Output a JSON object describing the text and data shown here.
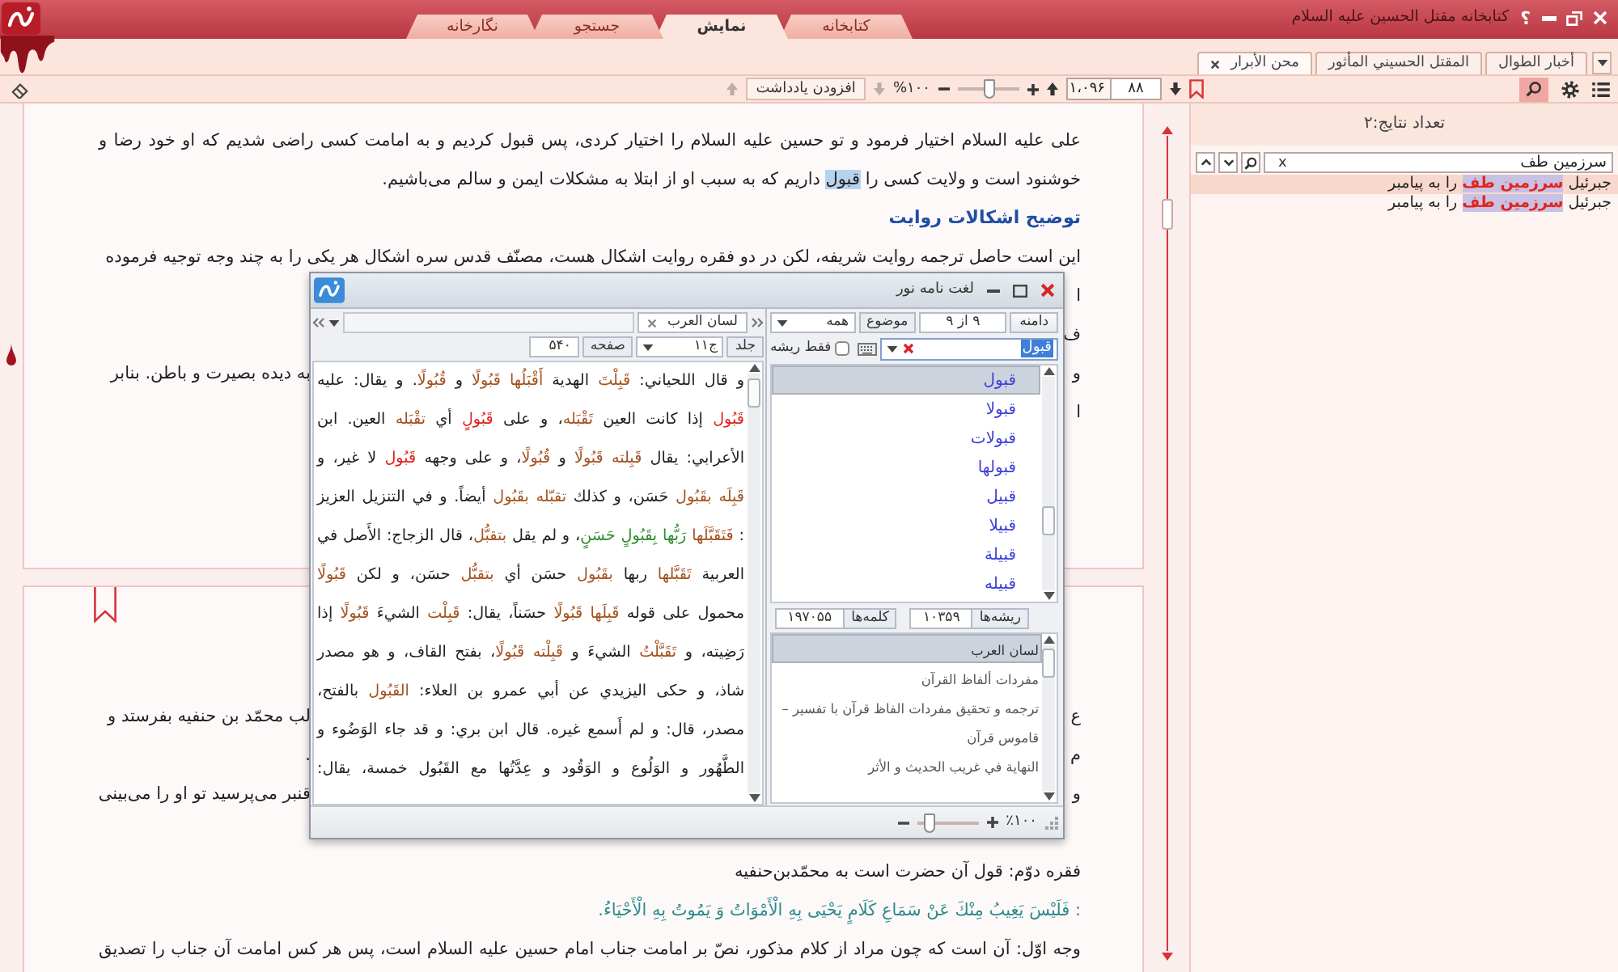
{
  "window": {
    "title": "کتابخانه مقتل الحسین علیه السلام",
    "help": "؟"
  },
  "main_tabs": [
    {
      "label": "کتابخانه",
      "selected": false
    },
    {
      "label": "نمایش",
      "selected": true
    },
    {
      "label": "جستجو",
      "selected": false
    },
    {
      "label": "نگارخانه",
      "selected": false
    }
  ],
  "document_tabs": [
    {
      "label": "أخبار الطوال",
      "selected": false
    },
    {
      "label": "المقتل الحسيني المأثور",
      "selected": false
    },
    {
      "label": "محن الأبرار",
      "selected": true
    }
  ],
  "toolbar": {
    "search_active": true,
    "page_down": {
      "disabled": false
    },
    "page": "۸۸",
    "total_pages": "۱،۰۹۶",
    "page_up": {
      "disabled": false
    },
    "zoom_slider": {
      "level": 0.5
    },
    "zoom_text": "%۱۰۰",
    "note_down": {
      "disabled": true
    },
    "add_note": "افزودن یادداشت",
    "note_up": {
      "disabled": true
    }
  },
  "search_panel": {
    "result_count": "تعداد نتایج:۲",
    "query": "سرزمین طف",
    "clear": "x",
    "results": [
      {
        "text": "جبرئیل **سرزمین طف** را به پیامبر",
        "selected": true
      },
      {
        "text": "جبرئیل **سرزمین طف** را به پیامبر",
        "selected": false
      }
    ]
  },
  "document": {
    "sections": [
      {
        "bookmarked": false,
        "blocks": [
          {
            "kind": "paragraph",
            "continues": false,
            "lines": [
              [
                {
                  "kind": "plain",
                  "text": "علی علیه السلام اختیار فرمود و تو حسین علیه السلام را اختیار کردی، پس قبول کردیم و به امامت کسی راضی شدیم که او خود رضا و"
                }
              ],
              [
                {
                  "kind": "plain",
                  "text": "خوشنود است و ولایت کسی را "
                },
                {
                  "kind": "highlight",
                  "text": "قبول"
                },
                {
                  "kind": "plain",
                  "text": " داریم که به سبب او از ابتلا به مشکلات ایمن و سالم می‌باشیم."
                }
              ]
            ]
          },
          {
            "kind": "heading",
            "text": "توضیح اشکالات روایت"
          },
          {
            "kind": "paragraph",
            "lines": [
              [
                {
                  "kind": "plain",
                  "text": "این است حاصل ترجمه روایت شریفه، لکن در دو فقره روایت اشکال هست، مصنّف قدس سره اشکال هر یکی را به چند وجه توجیه فرموده"
                }
              ]
            ]
          },
          {
            "kind": "covered",
            "rows": [
              {
                "line_start": "ا"
              },
              {
                "line_start": "ف"
              },
              {
                "line_start": "و",
                "line_end": "به دیده بصیرت و باطن. بنابر"
              },
              {
                "line_start": "ا"
              }
            ]
          }
        ]
      },
      {
        "bookmarked": true,
        "blocks": [
          {
            "kind": "covered",
            "rows": [
              {
                "line_start": "ع",
                "line_end": "لب محمّد بن حنفیه بفرستد و"
              },
              {
                "line_start": "م",
                "line_end": "."
              },
              {
                "line_start": "و",
                "line_end": "قنبر می‌پرسید تو او را می‌بینی"
              }
            ]
          },
          {
            "kind": "paragraph",
            "continues": false,
            "lines": [
              [
                {
                  "kind": "plain",
                  "text": "فقره دوّم: قول آن حضرت است به محمّدبن‌حنفیه"
                }
              ]
            ]
          },
          {
            "kind": "verse",
            "text": ": فَلَيْسَ يَغِيبُ مِنْكَ عَنْ سَمَاعِ كَلَامٍ يَحْيَى بِهِ الْأَمْوَاتُ وَ يَمُوتُ بِهِ الْأَحْيَاءُ."
          },
          {
            "kind": "paragraph",
            "continues": true,
            "lines": [
              [
                {
                  "kind": "plain",
                  "text": "وجه اوّل: آن است که چون مراد از کلام مذکور، نصّ بر امامت جناب امام حسین علیه السلام است، پس هر کس امامت آن جناب را تصدیق"
                }
              ]
            ]
          }
        ]
      }
    ]
  },
  "dictionary_window": {
    "title": "لغت نامه نور",
    "book_tabs": [
      {
        "label": "لسان العرب",
        "selected": true
      }
    ],
    "volume_label": "جلد",
    "volume": "ج۱۱",
    "page_label": "صفحه",
    "page": "۵۴۰",
    "text_lines": [
      [
        {
          "kind": "plain",
          "text": "و قال اللحياني: "
        },
        {
          "kind": "derived",
          "text": "قَبِلْتَ"
        },
        {
          "kind": "plain",
          "text": " الهدية "
        },
        {
          "kind": "derived",
          "text": "أَقْبَلُها"
        },
        {
          "kind": "derived",
          "text": " قَبُولًا"
        },
        {
          "kind": "plain",
          "text": " و "
        },
        {
          "kind": "derived",
          "text": "قُبُولًا"
        },
        {
          "kind": "plain",
          "text": ". و يقال: عليه"
        }
      ],
      [
        {
          "kind": "exact",
          "text": "قَبُول"
        },
        {
          "kind": "plain",
          "text": " إذا كانت العين "
        },
        {
          "kind": "derived",
          "text": "تَقْبَله"
        },
        {
          "kind": "plain",
          "text": "، و على "
        },
        {
          "kind": "exact",
          "text": "قَبُولٍ"
        },
        {
          "kind": "plain",
          "text": " أي "
        },
        {
          "kind": "derived",
          "text": "تقْبَله"
        },
        {
          "kind": "plain",
          "text": " العين. ابن"
        }
      ],
      [
        {
          "kind": "plain",
          "text": "الأعرابي: يقال "
        },
        {
          "kind": "derived",
          "text": "قَبِلته"
        },
        {
          "kind": "derived",
          "text": " قَبُولًا"
        },
        {
          "kind": "plain",
          "text": " و "
        },
        {
          "kind": "derived",
          "text": "قُبُولًا"
        },
        {
          "kind": "plain",
          "text": "، و على وجهه "
        },
        {
          "kind": "exact",
          "text": "قَبُول"
        },
        {
          "kind": "plain",
          "text": " لا غير، و"
        }
      ],
      [
        {
          "kind": "derived",
          "text": "قَبِلَه"
        },
        {
          "kind": "derived",
          "text": " بقَبُول"
        },
        {
          "kind": "plain",
          "text": " حَسَن، و كذلك "
        },
        {
          "kind": "derived",
          "text": "تقبّله"
        },
        {
          "kind": "derived",
          "text": " بقَبُول"
        },
        {
          "kind": "plain",
          "text": " أيضاً. و في التنزيل العزيز"
        }
      ],
      [
        {
          "kind": "plain",
          "text": ": "
        },
        {
          "kind": "derived",
          "text": "فَتَقَبَّلَها"
        },
        {
          "kind": "verse",
          "text": " رَبُّها بِقَبُولٍ حَسَنٍ"
        },
        {
          "kind": "plain",
          "text": "، و لم يقل "
        },
        {
          "kind": "derived",
          "text": "بتقبُّل"
        },
        {
          "kind": "plain",
          "text": "، قال الزجاج: الأَصل في"
        }
      ],
      [
        {
          "kind": "plain",
          "text": "العربية "
        },
        {
          "kind": "derived",
          "text": "تَقَبَّلها"
        },
        {
          "kind": "plain",
          "text": " ربها "
        },
        {
          "kind": "derived",
          "text": "بقَبُول"
        },
        {
          "kind": "plain",
          "text": " حسَن أي "
        },
        {
          "kind": "derived",
          "text": "بتقبُّل"
        },
        {
          "kind": "plain",
          "text": " حسَن، و لكن "
        },
        {
          "kind": "derived",
          "text": "قَبُولًا"
        }
      ],
      [
        {
          "kind": "plain",
          "text": "محمول على قوله "
        },
        {
          "kind": "derived",
          "text": "قَبِلَها"
        },
        {
          "kind": "derived",
          "text": " قَبُولًا"
        },
        {
          "kind": "plain",
          "text": " حسَناً، يقال: "
        },
        {
          "kind": "derived",
          "text": "قَبِلْت"
        },
        {
          "kind": "plain",
          "text": " الشيءَ "
        },
        {
          "kind": "derived",
          "text": "قَبُولًا"
        },
        {
          "kind": "plain",
          "text": " إذا"
        }
      ],
      [
        {
          "kind": "plain",
          "text": "رَضِيته، و "
        },
        {
          "kind": "derived",
          "text": "تَقَبَّلْتُ"
        },
        {
          "kind": "plain",
          "text": " الشيءَ و "
        },
        {
          "kind": "derived",
          "text": "قَبِلْته"
        },
        {
          "kind": "derived",
          "text": " قَبُولًا"
        },
        {
          "kind": "plain",
          "text": "، بفتح القاف، و هو مصدر"
        }
      ],
      [
        {
          "kind": "plain",
          "text": "شاذ، و حكى اليزيدي عن أبي عمرو بن العلاء: "
        },
        {
          "kind": "derived",
          "text": "القَبُول"
        },
        {
          "kind": "plain",
          "text": " بالفتح،"
        }
      ],
      [
        {
          "kind": "plain",
          "text": "مصدر، قال: و لم أَسمع غيره. قال ابن بري: و قد جاء الوَضُوء و"
        }
      ],
      [
        {
          "kind": "plain",
          "text": "الطَّهُور و الوَلُوع و الوَقُود و عِدَّتُها مع القَبُول خمسة، يقال:"
        }
      ]
    ],
    "scope_button": "دامنه",
    "match_count": "۹ از ۹",
    "topic_label": "موضوع",
    "topic": "همه",
    "search": {
      "value": "قبول",
      "text_selected": true
    },
    "root_only": {
      "label": "فقط ریشه",
      "checked": false
    },
    "words": [
      {
        "text": "قبول",
        "selected": true
      },
      {
        "text": "قبولا",
        "selected": false
      },
      {
        "text": "قبولات",
        "selected": false
      },
      {
        "text": "قبولها",
        "selected": false
      },
      {
        "text": "قبیل",
        "selected": false
      },
      {
        "text": "قبیلا",
        "selected": false
      },
      {
        "text": "قبیلة",
        "selected": false
      },
      {
        "text": "قبیله",
        "selected": false
      }
    ],
    "roots_label": "ریشه‌ها",
    "roots_count": "۱۰۳۵۹",
    "words_label": "کلمه‌ها",
    "words_count": "۱۹۷۰۵۵",
    "books": [
      {
        "title": "لسان العرب",
        "selected": true
      },
      {
        "title": "مفردات ألفاظ القرآن",
        "selected": false
      },
      {
        "title": "ترجمه و تحقیق مفردات الفاظ قرآن با تفسیر –",
        "selected": false
      },
      {
        "title": "قاموس قرآن",
        "selected": false
      },
      {
        "title": "النهایة في غریب الحدیث و الأثر",
        "selected": false
      }
    ],
    "zoom_text": "٪۱۰۰",
    "zoom_slider": {
      "level": 0.2
    }
  }
}
